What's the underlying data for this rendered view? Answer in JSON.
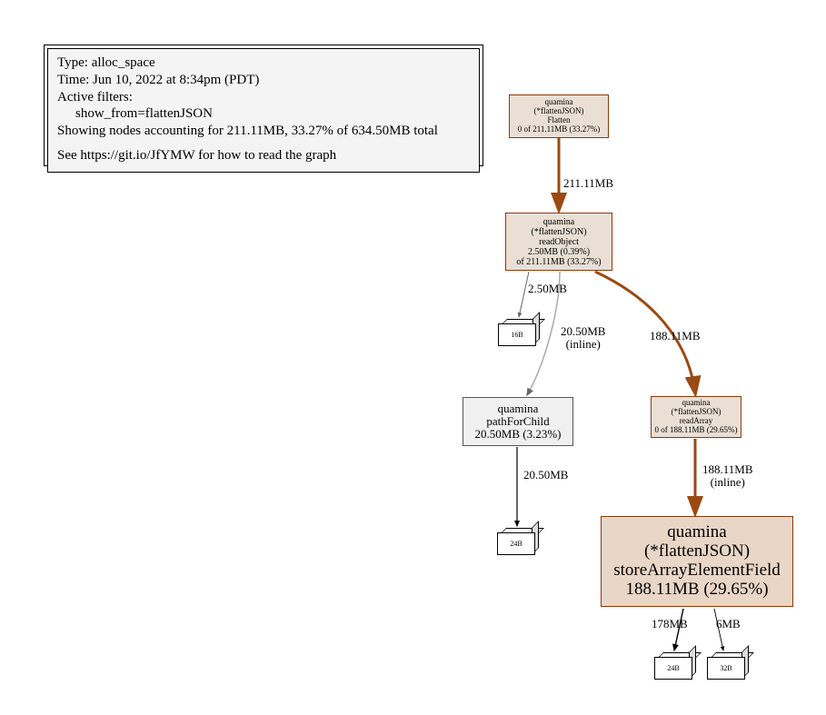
{
  "info": {
    "type_line": "Type: alloc_space",
    "time_line": "Time: Jun 10, 2022 at 8:34pm (PDT)",
    "filters_header": "Active filters:",
    "filter1": "show_from=flattenJSON",
    "showing_line": "Showing nodes accounting for 211.11MB, 33.27% of 634.50MB total",
    "see_line": "See https://git.io/JfYMW for how to read the graph"
  },
  "nodes": {
    "flatten": {
      "l1": "quamina",
      "l2": "(*flattenJSON)",
      "l3": "Flatten",
      "l4": "0 of 211.11MB (33.27%)"
    },
    "readObject": {
      "l1": "quamina",
      "l2": "(*flattenJSON)",
      "l3": "readObject",
      "l4": "2.50MB (0.39%)",
      "l5": "of 211.11MB (33.27%)"
    },
    "pathForChild": {
      "l1": "quamina",
      "l2": "pathForChild",
      "l3": "20.50MB (3.23%)"
    },
    "readArray": {
      "l1": "quamina",
      "l2": "(*flattenJSON)",
      "l3": "readArray",
      "l4": "0 of 188.11MB (29.65%)"
    },
    "storeArray": {
      "l1": "quamina",
      "l2": "(*flattenJSON)",
      "l3": "storeArrayElementField",
      "l4": "188.11MB (29.65%)"
    }
  },
  "leafs": {
    "b16": "16B",
    "b24a": "24B",
    "b24b": "24B",
    "b32": "32B"
  },
  "edges": {
    "e_flatten_readObject": "211.11MB",
    "e_readObject_16B": "2.50MB",
    "e_readObject_pathForChild_l1": "20.50MB",
    "e_readObject_pathForChild_l2": "(inline)",
    "e_readObject_readArray": "188.11MB",
    "e_pathForChild_24B": "20.50MB",
    "e_readArray_store_l1": "188.11MB",
    "e_readArray_store_l2": "(inline)",
    "e_store_24B": "178MB",
    "e_store_32B": "6MB"
  },
  "chart_data": {
    "type": "other",
    "profile_type": "alloc_space",
    "timestamp": "Jun 10, 2022 at 8:34pm (PDT)",
    "active_filters": [
      "show_from=flattenJSON"
    ],
    "total_mb": 634.5,
    "shown_mb": 211.11,
    "shown_pct": 33.27,
    "help_url": "https://git.io/JfYMW",
    "nodes": [
      {
        "id": "Flatten",
        "pkg": "quamina",
        "recv": "*flattenJSON",
        "func": "Flatten",
        "flat_mb": 0,
        "cum_mb": 211.11,
        "cum_pct": 33.27
      },
      {
        "id": "readObject",
        "pkg": "quamina",
        "recv": "*flattenJSON",
        "func": "readObject",
        "flat_mb": 2.5,
        "flat_pct": 0.39,
        "cum_mb": 211.11,
        "cum_pct": 33.27
      },
      {
        "id": "pathForChild",
        "pkg": "quamina",
        "func": "pathForChild",
        "flat_mb": 20.5,
        "flat_pct": 3.23
      },
      {
        "id": "readArray",
        "pkg": "quamina",
        "recv": "*flattenJSON",
        "func": "readArray",
        "flat_mb": 0,
        "cum_mb": 188.11,
        "cum_pct": 29.65
      },
      {
        "id": "storeArrayElementField",
        "pkg": "quamina",
        "recv": "*flattenJSON",
        "func": "storeArrayElementField",
        "flat_mb": 188.11,
        "flat_pct": 29.65
      },
      {
        "id": "leaf16B",
        "alloc_size": "16B"
      },
      {
        "id": "leaf24B_a",
        "alloc_size": "24B"
      },
      {
        "id": "leaf24B_b",
        "alloc_size": "24B"
      },
      {
        "id": "leaf32B",
        "alloc_size": "32B"
      }
    ],
    "edges": [
      {
        "from": "Flatten",
        "to": "readObject",
        "mb": 211.11
      },
      {
        "from": "readObject",
        "to": "leaf16B",
        "mb": 2.5
      },
      {
        "from": "readObject",
        "to": "pathForChild",
        "mb": 20.5,
        "inline": true
      },
      {
        "from": "readObject",
        "to": "readArray",
        "mb": 188.11
      },
      {
        "from": "pathForChild",
        "to": "leaf24B_a",
        "mb": 20.5
      },
      {
        "from": "readArray",
        "to": "storeArrayElementField",
        "mb": 188.11,
        "inline": true
      },
      {
        "from": "storeArrayElementField",
        "to": "leaf24B_b",
        "mb": 178
      },
      {
        "from": "storeArrayElementField",
        "to": "leaf32B",
        "mb": 6
      }
    ]
  }
}
